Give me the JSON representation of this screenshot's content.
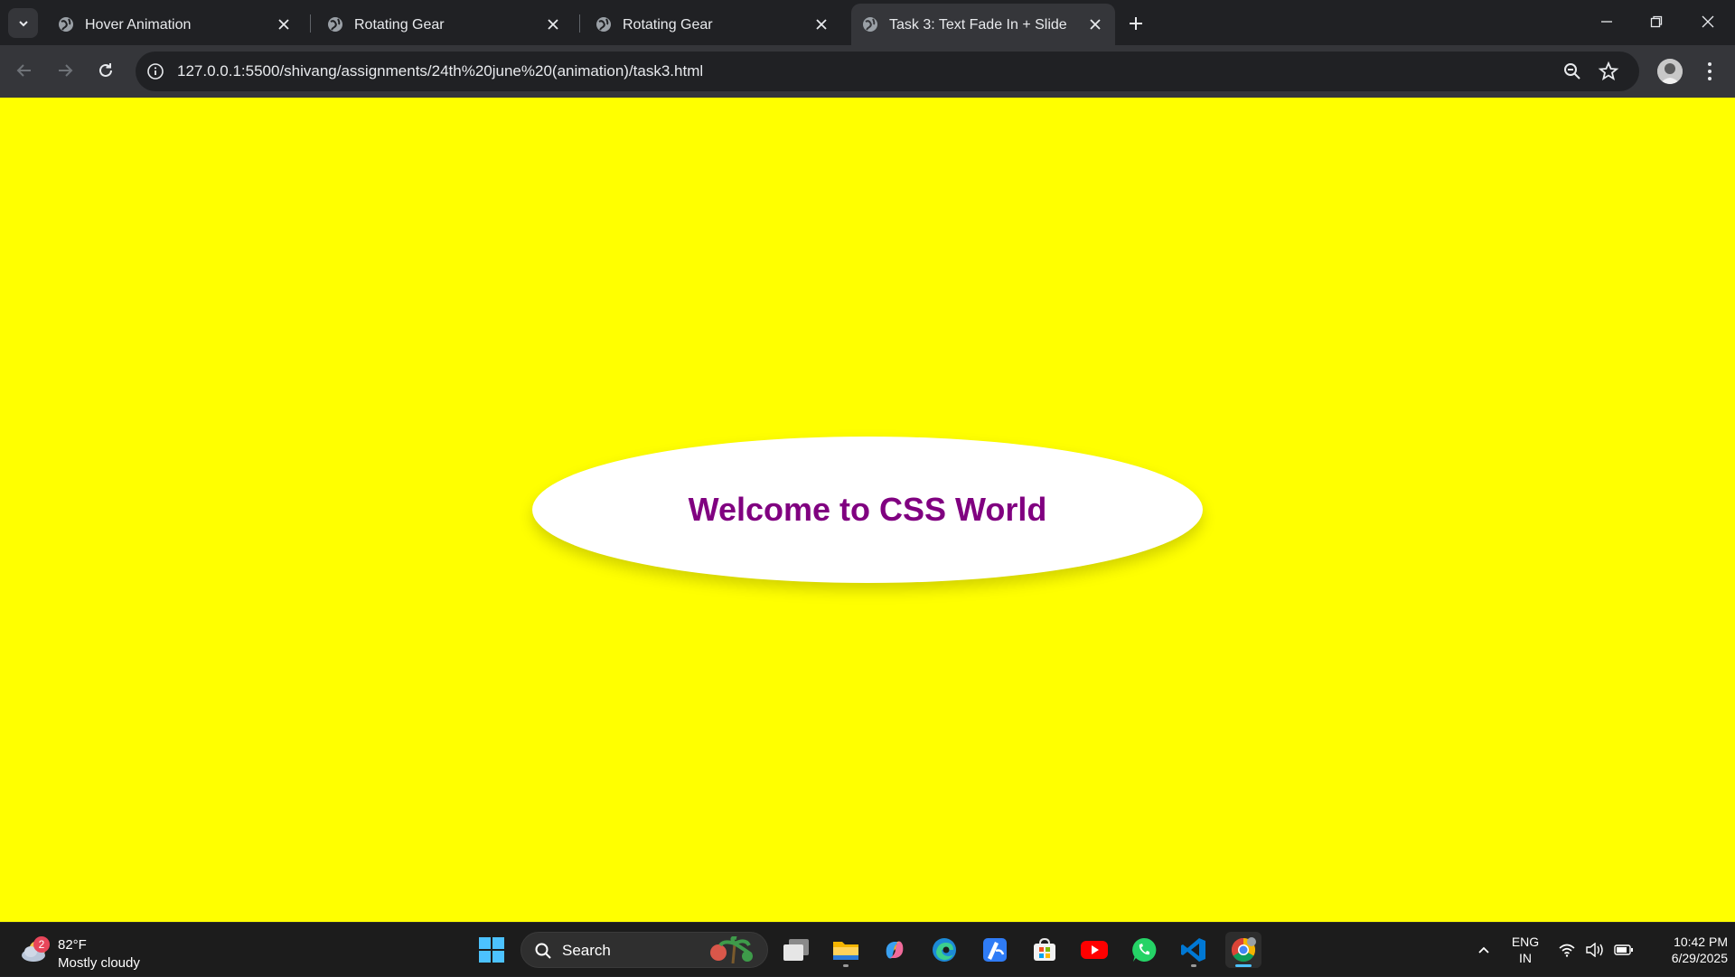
{
  "browser": {
    "tabs": [
      {
        "title": "Hover Animation",
        "active": false
      },
      {
        "title": "Rotating Gear",
        "active": false
      },
      {
        "title": "Rotating Gear",
        "active": false
      },
      {
        "title": "Task 3: Text Fade In + Slide",
        "active": true
      }
    ],
    "url": "127.0.0.1:5500/shivang/assignments/24th%20june%20(animation)/task3.html"
  },
  "page": {
    "background_color": "#ffff00",
    "heading": "Welcome to CSS World",
    "heading_color": "#800080"
  },
  "taskbar": {
    "weather": {
      "badge": "2",
      "temperature": "82°F",
      "condition": "Mostly cloudy"
    },
    "search_label": "Search",
    "language": {
      "line1": "ENG",
      "line2": "IN"
    },
    "time": "10:42 PM",
    "date": "6/29/2025"
  }
}
